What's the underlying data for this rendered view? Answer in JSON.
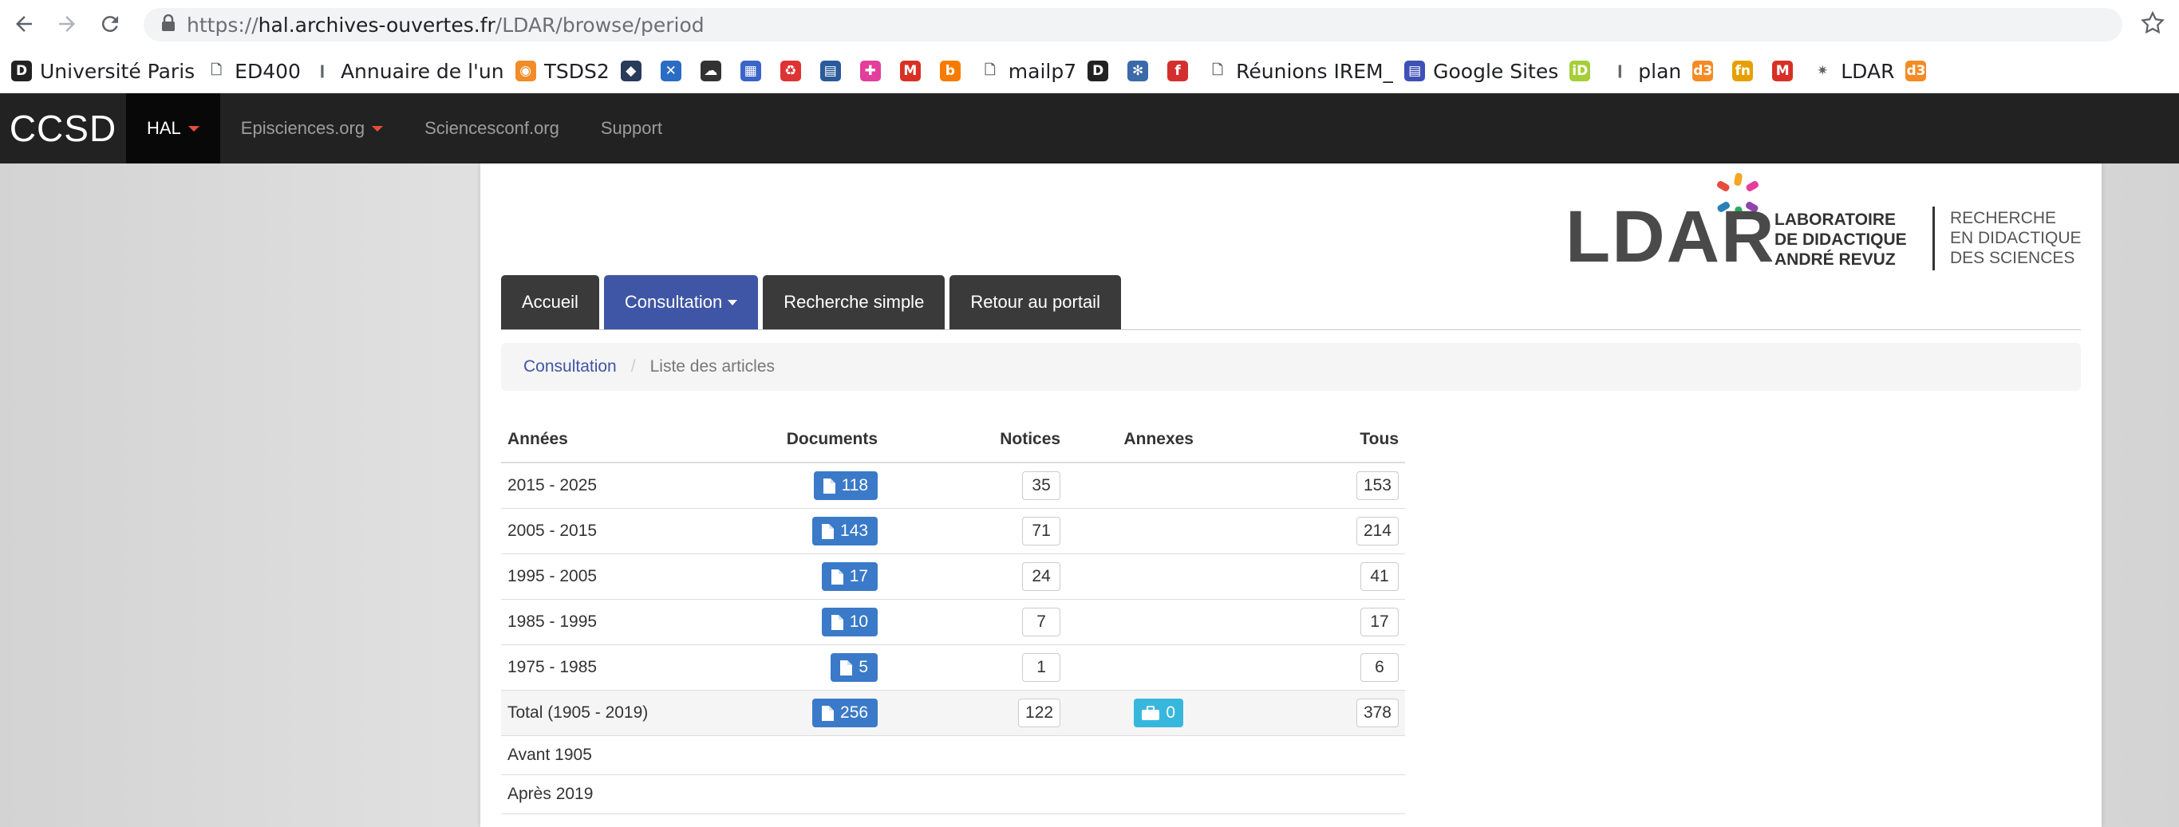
{
  "browser": {
    "url_scheme": "https://",
    "url_host": "hal.archives-ouvertes.fr",
    "url_path": "/LDAR/browse/period"
  },
  "bookmarks": [
    {
      "label": "Université Paris",
      "icon": "d-icon",
      "color": "#222222"
    },
    {
      "label": "ED400",
      "icon": "page-icon",
      "color": ""
    },
    {
      "label": "Annuaire de l'un",
      "icon": "fork-icon",
      "color": ""
    },
    {
      "label": "TSDS2",
      "icon": "orange-circle-icon",
      "color": "#f28c28"
    },
    {
      "label": "",
      "icon": "gem-icon",
      "color": "#2a3a5a"
    },
    {
      "label": "",
      "icon": "x-icon",
      "color": "#2b6cc4"
    },
    {
      "label": "",
      "icon": "cloud-icon",
      "color": "#333333"
    },
    {
      "label": "",
      "icon": "chart-icon",
      "color": "#3b64c8"
    },
    {
      "label": "",
      "icon": "recycle-icon",
      "color": "#d33"
    },
    {
      "label": "",
      "icon": "book-icon",
      "color": "#2a5a9a"
    },
    {
      "label": "",
      "icon": "puzzle-icon",
      "color": "#e33e9c"
    },
    {
      "label": "",
      "icon": "gmail-icon",
      "color": "#d93025"
    },
    {
      "label": "",
      "icon": "b-circle-icon",
      "color": "#f57c00"
    },
    {
      "label": "mailp7",
      "icon": "page-icon",
      "color": ""
    },
    {
      "label": "",
      "icon": "d-icon",
      "color": "#222222"
    },
    {
      "label": "",
      "icon": "snowflake-icon",
      "color": "#3a6aa8"
    },
    {
      "label": "",
      "icon": "f-icon",
      "color": "#d32f2f"
    },
    {
      "label": "Réunions IREM_",
      "icon": "page-icon",
      "color": ""
    },
    {
      "label": "Google Sites",
      "icon": "sites-icon",
      "color": "#3f51b5"
    },
    {
      "label": "",
      "icon": "id-icon",
      "color": "#a6ce39"
    },
    {
      "label": "plan",
      "icon": "fork-icon",
      "color": ""
    },
    {
      "label": "",
      "icon": "d3-icon",
      "color": "#f48b25"
    },
    {
      "label": "",
      "icon": "fn-icon",
      "color": "#e5a000"
    },
    {
      "label": "",
      "icon": "gmail-icon",
      "color": "#d93025"
    },
    {
      "label": "LDAR",
      "icon": "ldar-star-icon",
      "color": ""
    },
    {
      "label": "",
      "icon": "d3-icon",
      "color": "#f48b25"
    }
  ],
  "site_nav": {
    "logo": "CCSD",
    "items": [
      {
        "label": "HAL",
        "caret": true,
        "active": true
      },
      {
        "label": "Episciences.org",
        "caret": true,
        "active": false
      },
      {
        "label": "Sciencesconf.org",
        "caret": false,
        "active": false
      },
      {
        "label": "Support",
        "caret": false,
        "active": false
      }
    ]
  },
  "logo": {
    "text": "LDAR",
    "lab_lines": [
      "LABORATOIRE",
      "DE DIDACTIQUE",
      "ANDRÉ REVUZ"
    ],
    "rech_lines": [
      "RECHERCHE",
      "EN DIDACTIQUE",
      "DES SCIENCES"
    ]
  },
  "tabs": [
    {
      "label": "Accueil",
      "active": false
    },
    {
      "label": "Consultation",
      "active": true,
      "caret": true
    },
    {
      "label": "Recherche simple",
      "active": false
    },
    {
      "label": "Retour au portail",
      "active": false
    }
  ],
  "breadcrumb": {
    "link": "Consultation",
    "separator": "/",
    "current": "Liste des articles"
  },
  "table": {
    "headers": {
      "years": "Années",
      "documents": "Documents",
      "notices": "Notices",
      "annexes": "Annexes",
      "all": "Tous"
    },
    "rows": [
      {
        "years": "2015 - 2025",
        "documents": "118",
        "notices": "35",
        "annexes": "",
        "all": "153"
      },
      {
        "years": "2005 - 2015",
        "documents": "143",
        "notices": "71",
        "annexes": "",
        "all": "214"
      },
      {
        "years": "1995 - 2005",
        "documents": "17",
        "notices": "24",
        "annexes": "",
        "all": "41"
      },
      {
        "years": "1985 - 1995",
        "documents": "10",
        "notices": "7",
        "annexes": "",
        "all": "17"
      },
      {
        "years": "1975 - 1985",
        "documents": "5",
        "notices": "1",
        "annexes": "",
        "all": "6"
      }
    ],
    "total": {
      "years": "Total (1905 - 2019)",
      "documents": "256",
      "notices": "122",
      "annexes": "0",
      "all": "378"
    },
    "extra_rows": [
      "Avant 1905",
      "Après 2019"
    ]
  },
  "colors": {
    "doc_button": "#3a7ac8",
    "annex_button": "#38b7dd",
    "active_tab": "#3f55a5",
    "navbar": "#222222"
  }
}
